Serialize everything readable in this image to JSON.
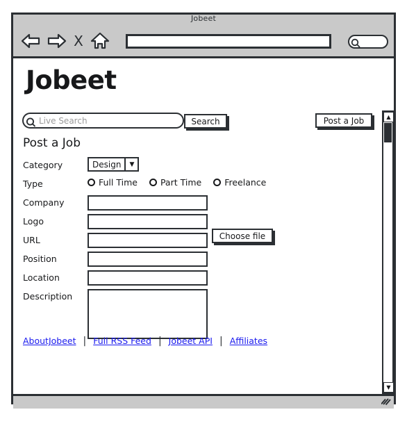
{
  "window": {
    "title": "Jobeet",
    "nav": {
      "back_icon": "back-arrow-icon",
      "forward_icon": "forward-arrow-icon",
      "stop_label": "X",
      "home_icon": "home-icon",
      "url_value": "",
      "url_placeholder": "",
      "browser_search_value": "",
      "browser_search_icon": "magnifier-icon"
    },
    "status_bar": {
      "text": "",
      "grip_icon": "resize-grip-icon"
    }
  },
  "page": {
    "logo": "Jobeet",
    "live_search": {
      "icon": "magnifier-icon",
      "placeholder": "Live Search",
      "value": ""
    },
    "search_button": "Search",
    "post_job_button": "Post a Job",
    "form_title": "Post a Job",
    "form": {
      "category": {
        "label": "Category",
        "selected": "Design",
        "arrow": "▼"
      },
      "type": {
        "label": "Type",
        "options": [
          {
            "label": "Full Time",
            "checked": false
          },
          {
            "label": "Part Time",
            "checked": false
          },
          {
            "label": "Freelance",
            "checked": false
          }
        ]
      },
      "company": {
        "label": "Company",
        "value": ""
      },
      "logo": {
        "label": "Logo",
        "value": ""
      },
      "choose_file_button": "Choose file",
      "url": {
        "label": "URL",
        "value": ""
      },
      "position": {
        "label": "Position",
        "value": ""
      },
      "location": {
        "label": "Location",
        "value": ""
      },
      "description": {
        "label": "Description",
        "value": ""
      }
    },
    "footer_links": [
      "AboutJobeet",
      "Full RSS Feed",
      "Jobeet API",
      "Affiliates"
    ],
    "footer_separator": "|",
    "scrollbar": {
      "up_arrow": "▲",
      "down_arrow": "▼"
    }
  },
  "colors": {
    "ink": "#2b2f33",
    "chrome": "#c9c9c9",
    "link": "#1a1aee",
    "placeholder": "#9a9a9a"
  }
}
